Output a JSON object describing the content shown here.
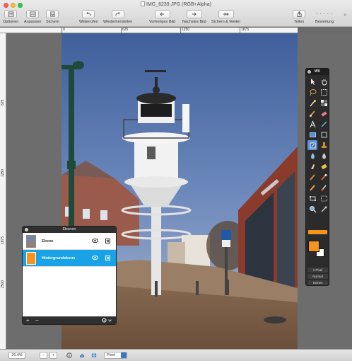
{
  "window": {
    "title": "IMG_6239.JPG (RGB+Alpha)"
  },
  "toolbar": {
    "optionen": "Optionen",
    "anpassen": "Anpassen",
    "sichern": "Sichern",
    "widerrufen": "Widerrufen",
    "wiederherstellen": "Wiederherstellen",
    "vorheriges": "Vorheriges Bild",
    "naechstes": "Nächstes Bild",
    "sichern_weiter": "Sichern & Weiter",
    "teilen": "Teilen",
    "bewertung": "Bewertung",
    "more": "»"
  },
  "ruler": {
    "h_labels": [
      "0",
      "625",
      "1250",
      "1875"
    ],
    "v_labels": [
      "625",
      "1250",
      "1875",
      "2500"
    ]
  },
  "tools_panel": {
    "title": "WK",
    "size_value": "1 Pixel",
    "blend_mode": "Normal",
    "option_2": "Keines",
    "fg_color": "#f7941e",
    "bg_color": "#ffffff"
  },
  "layers_panel": {
    "title": "Ebenen",
    "layers": [
      {
        "name": "Ebene",
        "active": false
      },
      {
        "name": "Hintergrundebene",
        "active": true
      }
    ],
    "add": "+",
    "remove": "−"
  },
  "statusbar": {
    "zoom": "26.4%",
    "minus": "−",
    "plus": "+",
    "unit": "Pixel"
  }
}
